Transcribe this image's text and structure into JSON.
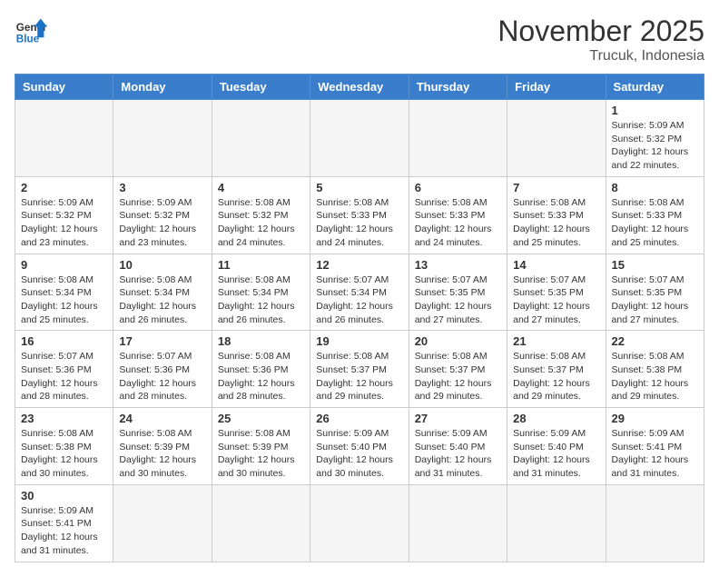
{
  "header": {
    "logo_general": "General",
    "logo_blue": "Blue",
    "month_title": "November 2025",
    "location": "Trucuk, Indonesia"
  },
  "weekdays": [
    "Sunday",
    "Monday",
    "Tuesday",
    "Wednesday",
    "Thursday",
    "Friday",
    "Saturday"
  ],
  "weeks": [
    [
      {
        "day": "",
        "info": ""
      },
      {
        "day": "",
        "info": ""
      },
      {
        "day": "",
        "info": ""
      },
      {
        "day": "",
        "info": ""
      },
      {
        "day": "",
        "info": ""
      },
      {
        "day": "",
        "info": ""
      },
      {
        "day": "1",
        "info": "Sunrise: 5:09 AM\nSunset: 5:32 PM\nDaylight: 12 hours\nand 22 minutes."
      }
    ],
    [
      {
        "day": "2",
        "info": "Sunrise: 5:09 AM\nSunset: 5:32 PM\nDaylight: 12 hours\nand 23 minutes."
      },
      {
        "day": "3",
        "info": "Sunrise: 5:09 AM\nSunset: 5:32 PM\nDaylight: 12 hours\nand 23 minutes."
      },
      {
        "day": "4",
        "info": "Sunrise: 5:08 AM\nSunset: 5:32 PM\nDaylight: 12 hours\nand 24 minutes."
      },
      {
        "day": "5",
        "info": "Sunrise: 5:08 AM\nSunset: 5:33 PM\nDaylight: 12 hours\nand 24 minutes."
      },
      {
        "day": "6",
        "info": "Sunrise: 5:08 AM\nSunset: 5:33 PM\nDaylight: 12 hours\nand 24 minutes."
      },
      {
        "day": "7",
        "info": "Sunrise: 5:08 AM\nSunset: 5:33 PM\nDaylight: 12 hours\nand 25 minutes."
      },
      {
        "day": "8",
        "info": "Sunrise: 5:08 AM\nSunset: 5:33 PM\nDaylight: 12 hours\nand 25 minutes."
      }
    ],
    [
      {
        "day": "9",
        "info": "Sunrise: 5:08 AM\nSunset: 5:34 PM\nDaylight: 12 hours\nand 25 minutes."
      },
      {
        "day": "10",
        "info": "Sunrise: 5:08 AM\nSunset: 5:34 PM\nDaylight: 12 hours\nand 26 minutes."
      },
      {
        "day": "11",
        "info": "Sunrise: 5:08 AM\nSunset: 5:34 PM\nDaylight: 12 hours\nand 26 minutes."
      },
      {
        "day": "12",
        "info": "Sunrise: 5:07 AM\nSunset: 5:34 PM\nDaylight: 12 hours\nand 26 minutes."
      },
      {
        "day": "13",
        "info": "Sunrise: 5:07 AM\nSunset: 5:35 PM\nDaylight: 12 hours\nand 27 minutes."
      },
      {
        "day": "14",
        "info": "Sunrise: 5:07 AM\nSunset: 5:35 PM\nDaylight: 12 hours\nand 27 minutes."
      },
      {
        "day": "15",
        "info": "Sunrise: 5:07 AM\nSunset: 5:35 PM\nDaylight: 12 hours\nand 27 minutes."
      }
    ],
    [
      {
        "day": "16",
        "info": "Sunrise: 5:07 AM\nSunset: 5:36 PM\nDaylight: 12 hours\nand 28 minutes."
      },
      {
        "day": "17",
        "info": "Sunrise: 5:07 AM\nSunset: 5:36 PM\nDaylight: 12 hours\nand 28 minutes."
      },
      {
        "day": "18",
        "info": "Sunrise: 5:08 AM\nSunset: 5:36 PM\nDaylight: 12 hours\nand 28 minutes."
      },
      {
        "day": "19",
        "info": "Sunrise: 5:08 AM\nSunset: 5:37 PM\nDaylight: 12 hours\nand 29 minutes."
      },
      {
        "day": "20",
        "info": "Sunrise: 5:08 AM\nSunset: 5:37 PM\nDaylight: 12 hours\nand 29 minutes."
      },
      {
        "day": "21",
        "info": "Sunrise: 5:08 AM\nSunset: 5:37 PM\nDaylight: 12 hours\nand 29 minutes."
      },
      {
        "day": "22",
        "info": "Sunrise: 5:08 AM\nSunset: 5:38 PM\nDaylight: 12 hours\nand 29 minutes."
      }
    ],
    [
      {
        "day": "23",
        "info": "Sunrise: 5:08 AM\nSunset: 5:38 PM\nDaylight: 12 hours\nand 30 minutes."
      },
      {
        "day": "24",
        "info": "Sunrise: 5:08 AM\nSunset: 5:39 PM\nDaylight: 12 hours\nand 30 minutes."
      },
      {
        "day": "25",
        "info": "Sunrise: 5:08 AM\nSunset: 5:39 PM\nDaylight: 12 hours\nand 30 minutes."
      },
      {
        "day": "26",
        "info": "Sunrise: 5:09 AM\nSunset: 5:40 PM\nDaylight: 12 hours\nand 30 minutes."
      },
      {
        "day": "27",
        "info": "Sunrise: 5:09 AM\nSunset: 5:40 PM\nDaylight: 12 hours\nand 31 minutes."
      },
      {
        "day": "28",
        "info": "Sunrise: 5:09 AM\nSunset: 5:40 PM\nDaylight: 12 hours\nand 31 minutes."
      },
      {
        "day": "29",
        "info": "Sunrise: 5:09 AM\nSunset: 5:41 PM\nDaylight: 12 hours\nand 31 minutes."
      }
    ],
    [
      {
        "day": "30",
        "info": "Sunrise: 5:09 AM\nSunset: 5:41 PM\nDaylight: 12 hours\nand 31 minutes."
      },
      {
        "day": "",
        "info": ""
      },
      {
        "day": "",
        "info": ""
      },
      {
        "day": "",
        "info": ""
      },
      {
        "day": "",
        "info": ""
      },
      {
        "day": "",
        "info": ""
      },
      {
        "day": "",
        "info": ""
      }
    ]
  ]
}
